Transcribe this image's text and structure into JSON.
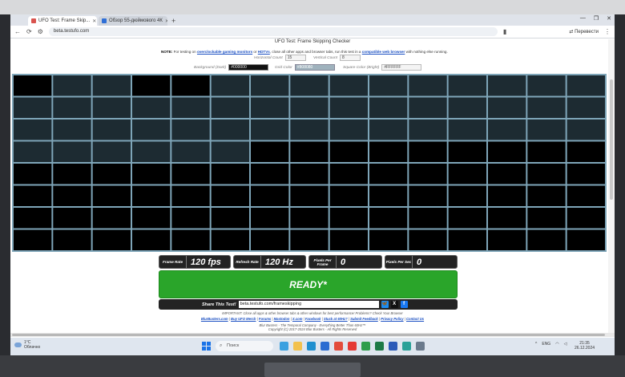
{
  "browser": {
    "tabs": [
      {
        "label": "UFO Test: Frame Skip...",
        "active": true,
        "favicon_color": "#d9534f"
      },
      {
        "label": "Обзор 55-дюймового 4К",
        "active": false,
        "favicon_color": "#2f6fd6"
      }
    ],
    "new_tab": "+",
    "url": "beta.testufo.com",
    "translate_label": "Перевести",
    "window_controls": [
      "—",
      "❐",
      "✕"
    ]
  },
  "page": {
    "title": "UFO Test: Frame Skipping Checker",
    "note": {
      "prefix": "NOTE:",
      "t1": " For testing on ",
      "link1": "overclockable gaming monitors",
      "t2": " or ",
      "link2": "HDTVs",
      "t3": ", close all other apps and browser tabs, run this test in a ",
      "link3": "compatible web browser",
      "t4": " with nothing else running."
    },
    "controls": {
      "horizontal_label": "Horizontal Count",
      "horizontal_value": "15",
      "vertical_label": "Vertical Count",
      "vertical_value": "8",
      "background_label": "Background (Dark)",
      "background_value": "#000000",
      "grid_label": "Grid Color",
      "grid_value": "#808080",
      "square_label": "Square Color (Bright)",
      "square_value": "#FFFFFF"
    },
    "grid": {
      "columns": 15,
      "rows": 8,
      "grid_color": "#7ea5b8",
      "dark_color": "#000000",
      "lit_color": "#1d2b32",
      "lit_cells": [
        [
          1,
          2,
          5,
          6,
          7,
          8,
          9,
          10,
          11,
          12,
          13,
          14
        ],
        [
          0,
          1,
          2,
          3,
          4,
          5,
          6,
          7,
          8,
          9,
          10,
          11,
          12,
          13,
          14
        ],
        [
          0,
          1,
          2,
          3,
          4,
          5,
          6,
          7,
          8,
          9,
          10,
          11,
          12,
          13,
          14
        ],
        [
          0,
          1,
          2,
          3,
          4,
          5
        ],
        [],
        [],
        [],
        []
      ]
    },
    "stats": [
      {
        "label": "Frame Rate",
        "value": "120 fps"
      },
      {
        "label": "Refresh Rate",
        "value": "120 Hz"
      },
      {
        "label": "Pixels Per Frame",
        "value": "0"
      },
      {
        "label": "Pixels Per Sec",
        "value": "0"
      }
    ],
    "ready_label": "READY*",
    "share": {
      "label": "Share This Test!",
      "url": "beta.testufo.com/frameskipping",
      "buttons": [
        {
          "label": "🦋",
          "color": "#1d8cf0"
        },
        {
          "label": "X",
          "color": "#111111"
        },
        {
          "label": "f",
          "color": "#1877f2"
        }
      ]
    },
    "footer": {
      "important": "IMPORTANT: Close all apps & other browser tabs & other windows for best performance! Problems? Check Your Browser",
      "links": [
        "BlurBusters.com",
        "Buy UFO Merch",
        "Forums",
        "Mastodon",
        "X.com",
        "Facebook",
        "Stuck at 60Hz?",
        "Submit Feedback",
        "Privacy Policy",
        "Contact Us"
      ],
      "tagline": "Blur Busters - The Temporal Company - Everything Better Than 60Hz™",
      "copyright": "Copyright (C) 2017-2024 Blur Busters - All Rights Reserved"
    }
  },
  "taskbar": {
    "weather_temp": "1°C",
    "weather_desc": "Облачно",
    "search_placeholder": "Поиск",
    "apps": [
      {
        "name": "widgets",
        "color": "#3aa0e0"
      },
      {
        "name": "file-explorer",
        "color": "#f2c14e"
      },
      {
        "name": "edge",
        "color": "#1f8fcf"
      },
      {
        "name": "store",
        "color": "#2b6cd1"
      },
      {
        "name": "chrome",
        "color": "#e34c3c"
      },
      {
        "name": "yandex",
        "color": "#e53935"
      },
      {
        "name": "app-green",
        "color": "#2e9e4b"
      },
      {
        "name": "excel",
        "color": "#1d7a45"
      },
      {
        "name": "word",
        "color": "#2b5ab8"
      },
      {
        "name": "app-teal",
        "color": "#2aa198"
      },
      {
        "name": "settings",
        "color": "#6b7a8c"
      }
    ],
    "lang": "ENG",
    "time": "21:35",
    "date": "26.12.2024"
  }
}
